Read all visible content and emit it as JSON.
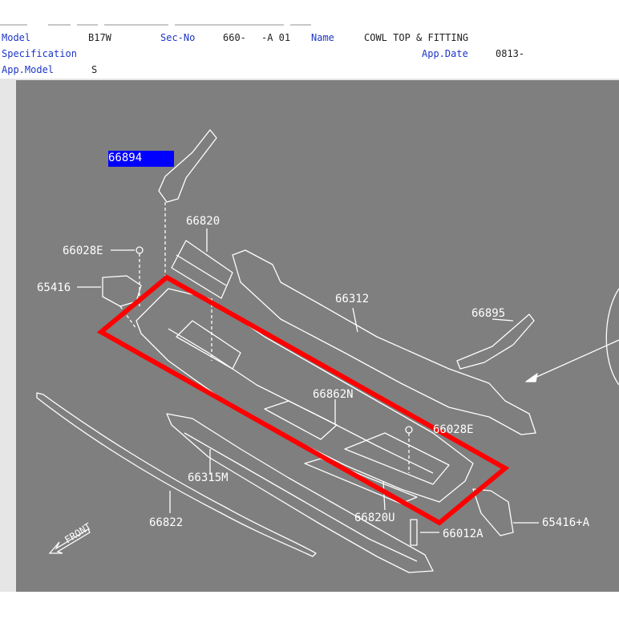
{
  "header": {
    "model_label": "Model",
    "model_value": "B17W",
    "secno_label": "Sec-No",
    "secno_value": "660-",
    "secno_suffix": "-A 01",
    "name_label": "Name",
    "name_value": "COWL TOP & FITTING",
    "spec_label": "Specification",
    "appdate_label": "App.Date",
    "appdate_value": "0813-",
    "appmodel_label": "App.Model",
    "appmodel_value": "S"
  },
  "parts": {
    "p66894": "66894",
    "p66820": "66820",
    "p66028E_top": "66028E",
    "p65416": "65416",
    "p66312": "66312",
    "p66895": "66895",
    "p66862N": "66862N",
    "p66028E_right": "66028E",
    "p66315M": "66315M",
    "p66822": "66822",
    "p66820U": "66820U",
    "p66012A": "66012A",
    "p65416A": "65416+A",
    "front": "FRONT"
  },
  "colors": {
    "background": "#7f7f7f",
    "highlight": "#0000ff",
    "callout_box": "#ff0000",
    "label_blue": "#1d35c8"
  }
}
